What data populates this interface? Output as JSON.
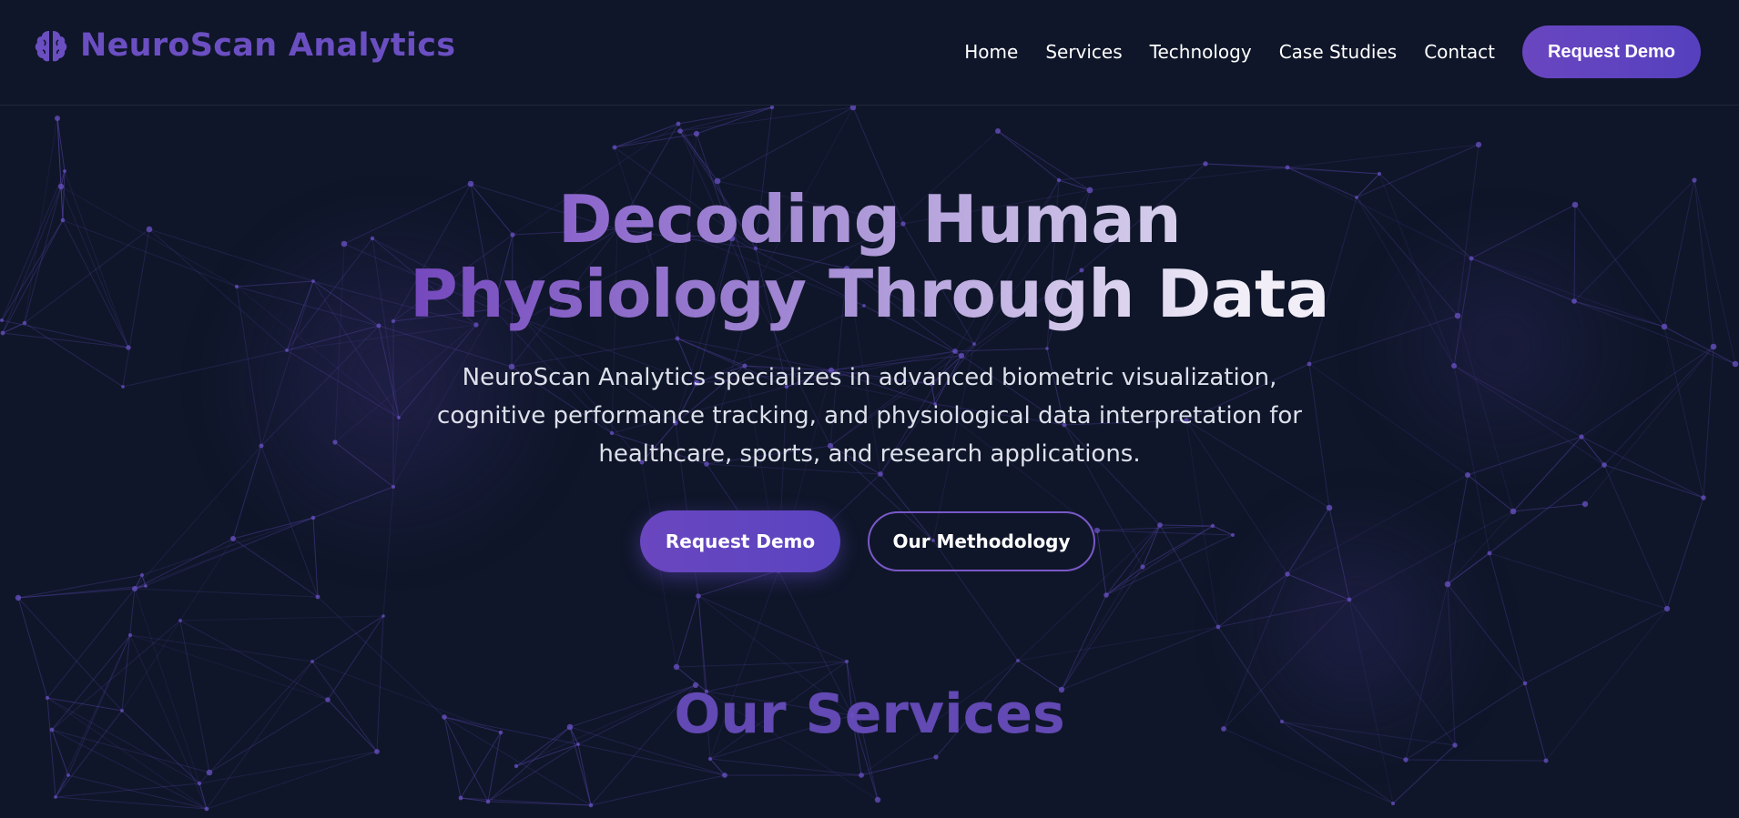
{
  "brand": {
    "name": "NeuroScan Analytics",
    "icon": "brain-icon"
  },
  "nav": {
    "items": [
      {
        "label": "Home"
      },
      {
        "label": "Services"
      },
      {
        "label": "Technology"
      },
      {
        "label": "Case Studies"
      },
      {
        "label": "Contact"
      }
    ],
    "cta_label": "Request Demo"
  },
  "hero": {
    "title_line1": "Decoding Human",
    "title_line2": "Physiology Through Data",
    "description": "NeuroScan Analytics specializes in advanced biometric visualization, cognitive performance tracking, and physiological data interpretation for healthcare, sports, and research applications.",
    "primary_cta": "Request Demo",
    "secondary_cta": "Our Methodology"
  },
  "next_section": {
    "title_partial": "Our Services"
  },
  "colors": {
    "background": "#0f1629",
    "accent": "#6b4fc2",
    "accent_button": "#6a46c0",
    "network_lines": "#5b45b0"
  }
}
